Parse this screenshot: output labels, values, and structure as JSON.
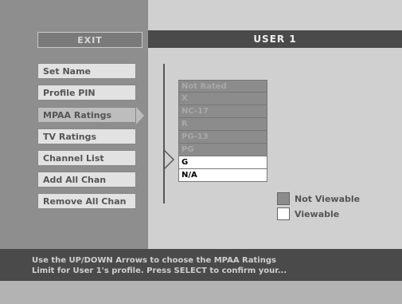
{
  "exit_label": "EXIT",
  "title": "USER 1",
  "menu": [
    {
      "label": "Set Name",
      "selected": false
    },
    {
      "label": "Profile PIN",
      "selected": false
    },
    {
      "label": "MPAA Ratings",
      "selected": true
    },
    {
      "label": "TV Ratings",
      "selected": false
    },
    {
      "label": "Channel List",
      "selected": false
    },
    {
      "label": "Add All Chan",
      "selected": false
    },
    {
      "label": "Remove All Chan",
      "selected": false
    }
  ],
  "ratings": [
    {
      "label": "Not Rated",
      "state": "not-viewable"
    },
    {
      "label": "X",
      "state": "not-viewable"
    },
    {
      "label": "NC-17",
      "state": "not-viewable"
    },
    {
      "label": "R",
      "state": "not-viewable"
    },
    {
      "label": "PG-13",
      "state": "not-viewable"
    },
    {
      "label": "PG",
      "state": "not-viewable"
    },
    {
      "label": "G",
      "state": "viewable"
    },
    {
      "label": "N/A",
      "state": "viewable"
    }
  ],
  "legend": {
    "not_viewable": {
      "label": "Not Viewable",
      "color": "#8c8c8c"
    },
    "viewable": {
      "label": "Viewable",
      "color": "#ffffff"
    }
  },
  "footer": {
    "line1": "Use the UP/DOWN Arrows to choose the MPAA Ratings",
    "line2": "Limit for User 1's profile.  Press SELECT to confirm your..."
  }
}
